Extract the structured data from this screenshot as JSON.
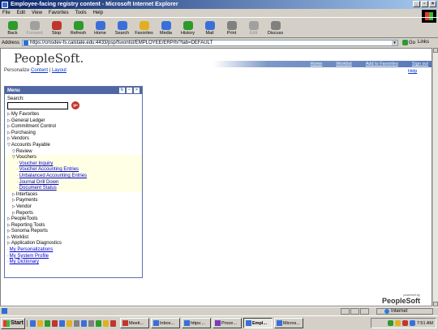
{
  "window": {
    "title": "Employee-facing registry content - Microsoft Internet Explorer"
  },
  "menubar": [
    "File",
    "Edit",
    "View",
    "Favorites",
    "Tools",
    "Help"
  ],
  "toolbar": [
    {
      "label": "Back",
      "icon": "back-arrow-icon",
      "color": "#2d9a2d",
      "disabled": false
    },
    {
      "label": "Forward",
      "icon": "forward-arrow-icon",
      "color": "#a0a0a0",
      "disabled": true
    },
    {
      "label": "Stop",
      "icon": "stop-icon",
      "color": "#c0362c",
      "disabled": false
    },
    {
      "label": "Refresh",
      "icon": "refresh-icon",
      "color": "#2d9a2d",
      "disabled": false
    },
    {
      "label": "Home",
      "icon": "home-icon",
      "color": "#3a6fd8",
      "disabled": false
    },
    {
      "label": "Search",
      "icon": "search-icon",
      "color": "#3a6fd8",
      "disabled": false
    },
    {
      "label": "Favorites",
      "icon": "favorites-star-icon",
      "color": "#e0b020",
      "disabled": false
    },
    {
      "label": "Media",
      "icon": "media-icon",
      "color": "#3a6fd8",
      "disabled": false
    },
    {
      "label": "History",
      "icon": "history-icon",
      "color": "#2d9a2d",
      "disabled": false
    },
    {
      "label": "Mail",
      "icon": "mail-icon",
      "color": "#3a6fd8",
      "disabled": false
    },
    {
      "label": "Print",
      "icon": "print-icon",
      "color": "#808080",
      "disabled": false
    },
    {
      "label": "Edit",
      "icon": "edit-icon",
      "color": "#a0a0a0",
      "disabled": true
    },
    {
      "label": "Discuss",
      "icon": "discuss-icon",
      "color": "#808080",
      "disabled": false
    }
  ],
  "address": {
    "label": "Address",
    "url": "https://cmsdev-fs.calstate.edu:4433/psp/fsxontst/EMPLOYEE/ERP/h/?tab=DEFAULT",
    "go": "Go",
    "links": "Links"
  },
  "brand": {
    "name": "PeopleSoft."
  },
  "topnav": [
    "Home",
    "Worklist",
    "Add to Favorites",
    "Sign out"
  ],
  "personalize": {
    "prefix": "Personalize",
    "content": "Content",
    "sep": "|",
    "layout": "Layout"
  },
  "help": "Help",
  "menu": {
    "title": "Menu",
    "search_label": "Search:",
    "search_value": "",
    "go_label": "go",
    "items": [
      {
        "label": "My Favorites",
        "level": 0,
        "type": "folder",
        "open": false
      },
      {
        "label": "General Ledger",
        "level": 0,
        "type": "folder",
        "open": false
      },
      {
        "label": "Commitment Control",
        "level": 0,
        "type": "folder",
        "open": false
      },
      {
        "label": "Purchasing",
        "level": 0,
        "type": "folder",
        "open": false
      },
      {
        "label": "Vendors",
        "level": 0,
        "type": "folder",
        "open": false
      },
      {
        "label": "Accounts Payable",
        "level": 0,
        "type": "folder",
        "open": true
      },
      {
        "label": "Review",
        "level": 1,
        "type": "folder",
        "open": true
      },
      {
        "label": "Vouchers",
        "level": 1,
        "type": "folder",
        "open": true,
        "hl": true
      },
      {
        "label": "Voucher Inquiry",
        "level": 2,
        "type": "link",
        "hl": true
      },
      {
        "label": "Voucher Accounting Entries",
        "level": 2,
        "type": "link",
        "hl": true
      },
      {
        "label": "Unbalanced Accounting Entries",
        "level": 2,
        "type": "link",
        "hl": true
      },
      {
        "label": "Journal Drill Down",
        "level": 2,
        "type": "link",
        "hl": true
      },
      {
        "label": "Document Status",
        "level": 2,
        "type": "link",
        "hl": true
      },
      {
        "label": "Interfaces",
        "level": 1,
        "type": "folder",
        "open": false
      },
      {
        "label": "Payments",
        "level": 1,
        "type": "folder",
        "open": false
      },
      {
        "label": "Vendor",
        "level": 1,
        "type": "folder",
        "open": false
      },
      {
        "label": "Reports",
        "level": 0,
        "type": "folder",
        "open": false,
        "indent": 1
      },
      {
        "label": "PeopleTools",
        "level": 0,
        "type": "folder",
        "open": false
      },
      {
        "label": "Reporting Tools",
        "level": 0,
        "type": "folder",
        "open": false
      },
      {
        "label": "Sonoma Reports",
        "level": 0,
        "type": "folder",
        "open": false
      },
      {
        "label": "Worklist",
        "level": 0,
        "type": "folder",
        "open": false
      },
      {
        "label": "Application Diagnostics",
        "level": 0,
        "type": "folder",
        "open": false
      },
      {
        "label": "My Personalizations",
        "level": 0,
        "type": "link"
      },
      {
        "label": "My System Profile",
        "level": 0,
        "type": "link"
      },
      {
        "label": "My Dictionary",
        "level": 0,
        "type": "link"
      }
    ]
  },
  "footer_logo": {
    "powered": "powered by",
    "name": "PeopleSoft"
  },
  "status": {
    "zone": "Internet"
  },
  "taskbar": {
    "start": "Start",
    "quicklaunch_colors": [
      "#3a6fd8",
      "#e0b020",
      "#2d9a2d",
      "#c0362c",
      "#3a6fd8",
      "#e0b020",
      "#808080",
      "#3a6fd8",
      "#808080",
      "#2d9a2d",
      "#e0b020",
      "#c0362c"
    ],
    "tasks": [
      {
        "label": "Meeti...",
        "color": "#c0362c",
        "active": false
      },
      {
        "label": "Inbox...",
        "color": "#3a6fd8",
        "active": false
      },
      {
        "label": "https:...",
        "color": "#3a6fd8",
        "active": false
      },
      {
        "label": "Proce...",
        "color": "#7a3ab8",
        "active": false
      },
      {
        "label": "Empl...",
        "color": "#3a6fd8",
        "active": true
      },
      {
        "label": "Micros...",
        "color": "#3a6fd8",
        "active": false
      }
    ],
    "tray_colors": [
      "#2d9a2d",
      "#e0b020",
      "#c0362c",
      "#3a6fd8"
    ],
    "clock": "7:51 AM"
  }
}
